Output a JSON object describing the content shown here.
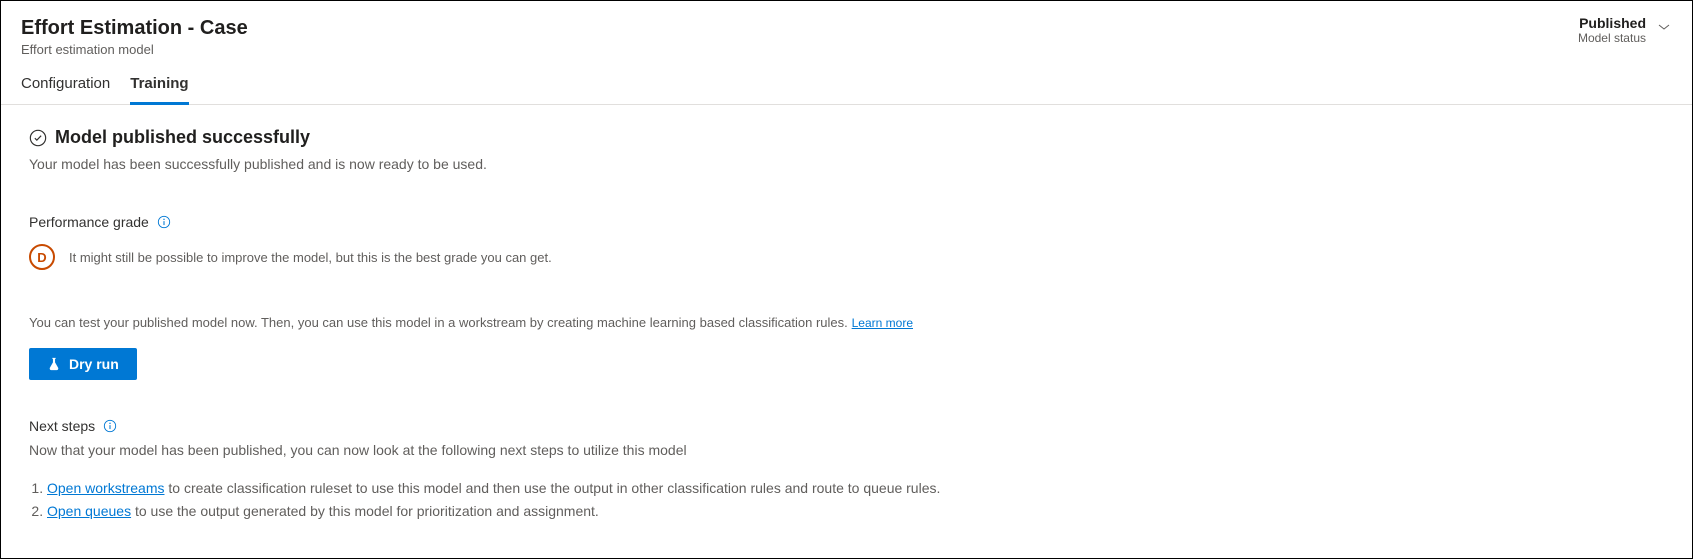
{
  "header": {
    "title": "Effort Estimation - Case",
    "subtitle": "Effort estimation model",
    "status_value": "Published",
    "status_label": "Model status"
  },
  "tabs": {
    "configuration": "Configuration",
    "training": "Training",
    "active": "training"
  },
  "success": {
    "title": "Model published successfully",
    "desc": "Your model has been successfully published and is now ready to be used."
  },
  "performance": {
    "label": "Performance grade",
    "grade": "D",
    "desc": "It might still be possible to improve the model, but this is the best grade you can get."
  },
  "test": {
    "text": "You can test your published model now. Then, you can use this model in a workstream by creating machine learning based classification rules.",
    "learn_more": "Learn more",
    "dry_run_label": "Dry run"
  },
  "next_steps": {
    "label": "Next steps",
    "desc": "Now that your model has been published, you can now look at the following next steps to utilize this model",
    "items": [
      {
        "link": "Open workstreams",
        "text": " to create classification ruleset to use this model and then use the output in other classification rules and route to queue rules."
      },
      {
        "link": "Open queues",
        "text": " to use the output generated by this model for prioritization and assignment."
      }
    ]
  }
}
